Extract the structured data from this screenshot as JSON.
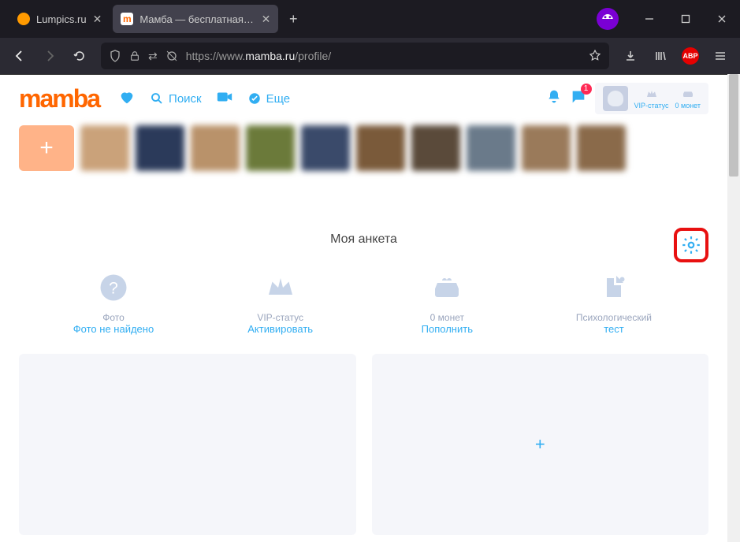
{
  "browser": {
    "tabs": [
      {
        "label": "Lumpics.ru",
        "active": false,
        "favicon": "#ff9a00"
      },
      {
        "label": "Мамба — бесплатная сеть зна",
        "active": true,
        "favicon": "#ff6600"
      }
    ],
    "url_prefix": "https://www.",
    "url_domain": "mamba.ru",
    "url_path": "/profile/",
    "minimize": "–",
    "maximize": "□",
    "close": "✕",
    "newtab": "+"
  },
  "site": {
    "logo": "mamba",
    "nav": {
      "search": "Поиск",
      "more": "Еще"
    },
    "userbox": {
      "vip": "VIP-статус",
      "coins": "0 монет"
    },
    "notif_count": "1"
  },
  "section_title": "Моя анкета",
  "cards": {
    "photo": {
      "title": "Фото",
      "action": "Фото не найдено"
    },
    "vip": {
      "title": "VIP-статус",
      "action": "Активировать"
    },
    "coins": {
      "title": "0 монет",
      "action": "Пополнить"
    },
    "test": {
      "title": "Психологический",
      "action": "тест"
    }
  },
  "thumbs": [
    "#caa27a",
    "#2b3a5a",
    "#b9926a",
    "#6b7a3a",
    "#3a4a6a",
    "#7a5a3a",
    "#5a4a3a",
    "#6a7a8a",
    "#9a7a5a",
    "#8a6a4a"
  ]
}
